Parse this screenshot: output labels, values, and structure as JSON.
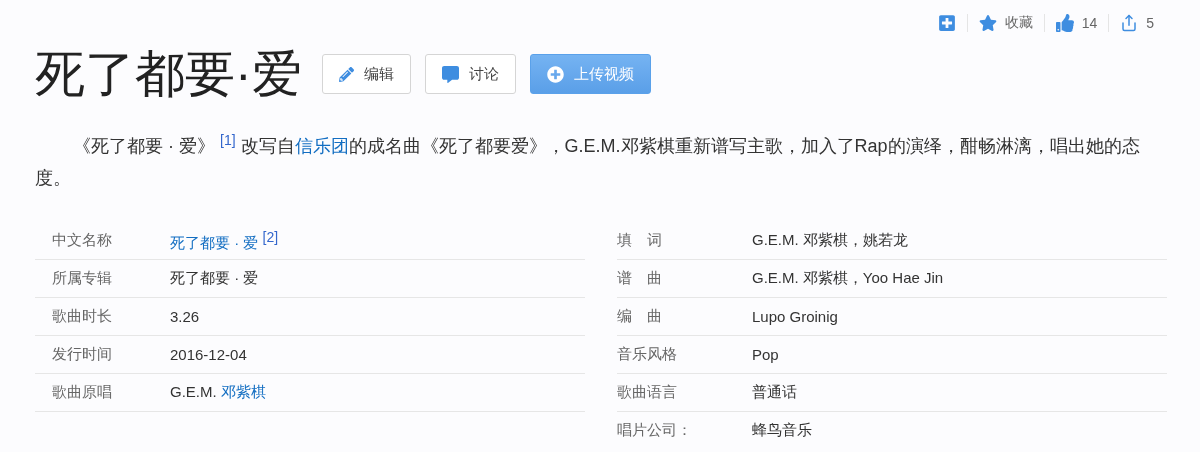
{
  "actions": [
    {
      "kind": "add"
    },
    {
      "kind": "star",
      "label": "收藏"
    },
    {
      "kind": "like",
      "label": "14"
    },
    {
      "kind": "share",
      "label": "5"
    }
  ],
  "title": "死了都要·爱",
  "buttons": [
    {
      "kind": "edit",
      "label": "编辑"
    },
    {
      "kind": "discuss",
      "label": "讨论"
    },
    {
      "kind": "upload",
      "label": "上传视频"
    }
  ],
  "intro": [
    {
      "kind": "text",
      "text": "《死了都要 · 爱》 "
    },
    {
      "kind": "ref",
      "text": "[1]"
    },
    {
      "kind": "text",
      "text": " 改写自"
    },
    {
      "kind": "link",
      "text": "信乐团"
    },
    {
      "kind": "text",
      "text": "的成名曲《死了都要爱》，G.E.M.邓紫棋重新谱写主歌，加入了Rap的演绎，酣畅淋漓，唱出她的态度。"
    }
  ],
  "info_left": [
    {
      "label": "中文名称",
      "link": "死了都要 · 爱",
      "ref": "[2]"
    },
    {
      "label": "所属专辑",
      "value": "死了都要 · 爱"
    },
    {
      "label": "歌曲时长",
      "value": "3.26"
    },
    {
      "label": "发行时间",
      "value": "2016-12-04"
    },
    {
      "label": "歌曲原唱",
      "value": "G.E.M.",
      "link": "邓紫棋"
    }
  ],
  "info_right": [
    {
      "label": "填　词",
      "value": "G.E.M. 邓紫棋，姚若龙"
    },
    {
      "label": "谱　曲",
      "value": "G.E.M. 邓紫棋，Yoo Hae Jin"
    },
    {
      "label": "编　曲",
      "value": "Lupo Groinig"
    },
    {
      "label": "音乐风格",
      "value": "Pop"
    },
    {
      "label": "歌曲语言",
      "value": "普通话"
    },
    {
      "label": "唱片公司：",
      "value": "蜂鸟音乐"
    }
  ]
}
